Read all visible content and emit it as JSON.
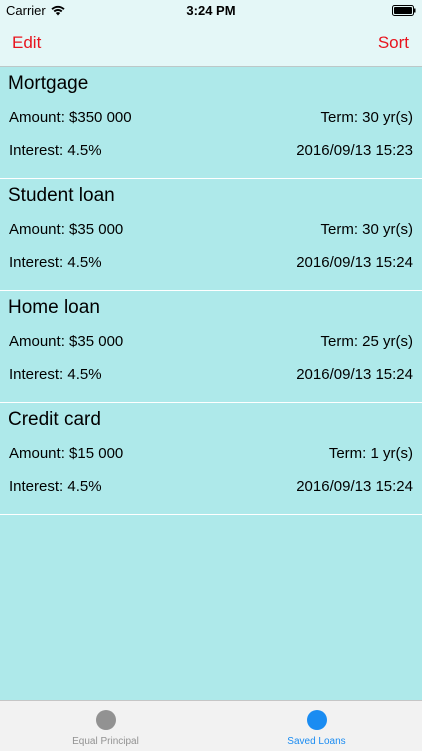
{
  "status_bar": {
    "carrier": "Carrier",
    "time": "3:24 PM",
    "wifi_icon": "wifi-icon",
    "battery_icon": "battery-icon"
  },
  "nav": {
    "edit_label": "Edit",
    "sort_label": "Sort",
    "accent_color": "#e8141e"
  },
  "loans": [
    {
      "name": "Mortgage",
      "amount": "Amount: $350 000",
      "term": "Term: 30 yr(s)",
      "interest": "Interest: 4.5%",
      "date": "2016/09/13 15:23"
    },
    {
      "name": "Student loan",
      "amount": "Amount: $35 000",
      "term": "Term: 30 yr(s)",
      "interest": "Interest: 4.5%",
      "date": "2016/09/13 15:24"
    },
    {
      "name": "Home loan",
      "amount": "Amount: $35 000",
      "term": "Term: 25 yr(s)",
      "interest": "Interest: 4.5%",
      "date": "2016/09/13 15:24"
    },
    {
      "name": "Credit card",
      "amount": "Amount: $15 000",
      "term": "Term: 1 yr(s)",
      "interest": "Interest: 4.5%",
      "date": "2016/09/13 15:24"
    }
  ],
  "tab_bar": {
    "tabs": [
      {
        "label": "Equal Principal",
        "icon": "circle-icon",
        "selected": false
      },
      {
        "label": "Saved Loans",
        "icon": "circle-icon",
        "selected": true
      }
    ],
    "active_color": "#1a8cf2",
    "inactive_color": "#929292"
  },
  "colors": {
    "background": "#aee9ea"
  }
}
